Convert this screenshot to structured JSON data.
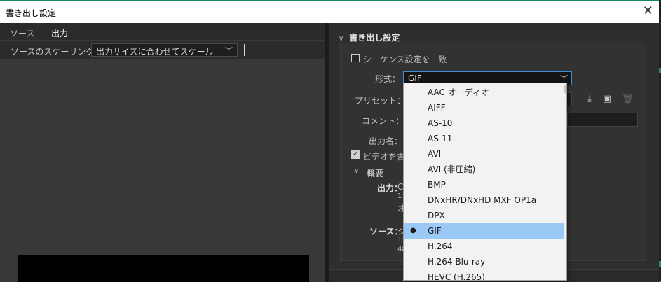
{
  "window": {
    "title": "書き出し設定",
    "close_glyph": "✕"
  },
  "left": {
    "tabs": [
      {
        "label": "ソース"
      },
      {
        "label": "出力"
      }
    ],
    "scaling": {
      "label": "ソースのスケーリング：",
      "value": "出力サイズに合わせてスケール"
    }
  },
  "export": {
    "section_label": "書き出し設定",
    "match_sequence_label": "シーケンス設定を一致",
    "format_label": "形式：",
    "format_value": "GIF",
    "preset_label": "プリセット：",
    "comment_label": "コメント：",
    "output_name_label": "出力名：",
    "export_video_label": "ビデオを書き",
    "summary_label": "概要",
    "output_label": "出力：",
    "output_lines": [
      "C",
      "1!",
      "オ"
    ],
    "source_label": "ソース：",
    "source_lines": [
      "シ",
      "1!",
      "48"
    ]
  },
  "format_options": [
    "AAC オーディオ",
    "AIFF",
    "AS-10",
    "AS-11",
    "AVI",
    "AVI (非圧縮)",
    "BMP",
    "DNxHR/DNxHD MXF OP1a",
    "DPX",
    "GIF",
    "H.264",
    "H.264 Blu-ray",
    "HEVC (H.265)"
  ],
  "selected_format_index": 9,
  "colors": {
    "accent": "#3d8ed4",
    "selection": "#99c9f4",
    "panel_dark": "#232323",
    "desktop_green": "#0c8c6a"
  },
  "icons": {
    "close": "close-icon",
    "chevron": "chevron-down-icon",
    "import": "import-preset-icon",
    "save": "save-preset-icon",
    "delete": "trash-icon"
  }
}
